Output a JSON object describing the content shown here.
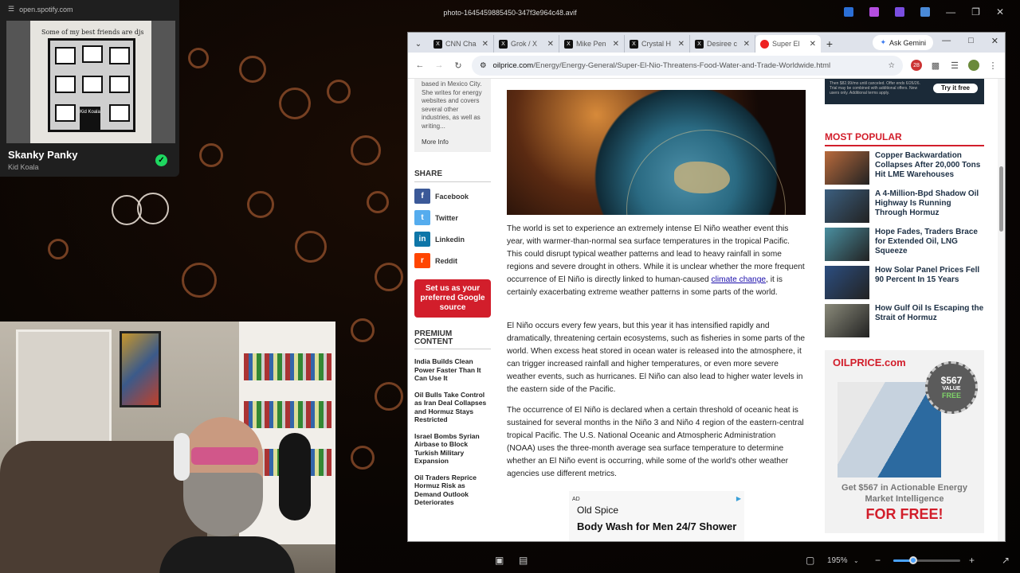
{
  "viewer": {
    "filename": "photo-1645459885450-347f3e964c48.avif",
    "zoom": "195%",
    "zoom_level": 0.3
  },
  "spotify": {
    "url": "open.spotify.com",
    "art_caption": "Some of my best friends are djs",
    "art_sign": "Kid Koala",
    "track": "Skanky Panky",
    "artist": "Kid Koala"
  },
  "browser": {
    "tabs": [
      {
        "label": "CNN Cha",
        "icon": "x-logo-icon"
      },
      {
        "label": "Grok / X",
        "icon": "x-logo-icon"
      },
      {
        "label": "Mike Pen",
        "icon": "x-logo-icon"
      },
      {
        "label": "Crystal H",
        "icon": "x-logo-icon"
      },
      {
        "label": "Desiree c",
        "icon": "x-logo-icon"
      },
      {
        "label": "Super El",
        "icon": "oilprice-icon"
      }
    ],
    "gemini_label": "Ask Gemini",
    "url_domain": "oilprice.com",
    "url_path": "/Energy/Energy-General/Super-El-Nio-Threatens-Food-Water-and-Trade-Worldwide.html",
    "ext_badge": "28"
  },
  "sidebar": {
    "author_bio": "based in Mexico City. She writes for energy websites and covers several other industries, as well as writing...",
    "more_info": "More Info",
    "share_heading": "SHARE",
    "share": [
      {
        "label": "Facebook",
        "glyph": "f",
        "color": "#3b5998"
      },
      {
        "label": "Twitter",
        "glyph": "t",
        "color": "#55acee"
      },
      {
        "label": "Linkedin",
        "glyph": "in",
        "color": "#0e76a8"
      },
      {
        "label": "Reddit",
        "glyph": "r",
        "color": "#ff4500"
      }
    ],
    "google_btn": "Set us as your preferred Google source",
    "premium_heading": "PREMIUM CONTENT",
    "premium": [
      "India Builds Clean Power Faster Than It Can Use It",
      "Oil Bulls Take Control as Iran Deal Collapses and Hormuz Stays Restricted",
      "Israel Bombs Syrian Airbase to Block Turkish Military Expansion",
      "Oil Traders Reprice Hormuz Risk as Demand Outlook Deteriorates"
    ]
  },
  "article": {
    "p1_a": "The world is set to experience an extremely intense El Niño weather event this year, with warmer-than-normal sea surface temperatures in the tropical Pacific. This could disrupt typical weather patterns and lead to heavy rainfall in some regions and severe drought in others. While it is unclear whether the more frequent occurrence of El Niño is directly linked to human-caused ",
    "p1_link": "climate change",
    "p1_b": ", it is certainly exacerbating extreme weather patterns in some parts of the world.",
    "p2": "El Niño occurs every few years, but this year it has intensified rapidly and dramatically, threatening certain ecosystems, such as fisheries in some parts of the world. When excess heat stored in ocean water is released into the atmosphere, it can trigger increased rainfall and higher temperatures, or even more severe weather events, such as hurricanes. El Niño can also lead to higher water levels in the eastern side of the Pacific.",
    "p3": "The occurrence of El Niño is declared when a certain threshold of oceanic heat is sustained for several months in the Niño 3 and Niño 4 region of the eastern-central tropical Pacific. The U.S. National Oceanic and Atmospheric Administration (NOAA) uses the three-month average sea surface temperature to determine whether an El Niño event is occurring, while some of the world's other weather agencies use different metrics.",
    "ad_tag": "AD",
    "ad_brand": "Old Spice",
    "ad_product": "Body Wash for Men 24/7 Shower"
  },
  "rightcol": {
    "promo_fine": "Then $82.99/mo until canceled. Offer ends 6/26/26. Trial may be combined with additional offers. New users only. Additional terms apply.",
    "try_btn": "Try it free",
    "most_popular": "MOST POPULAR",
    "items": [
      {
        "title": "Copper Backwardation Collapses After 20,000 Tons Hit LME Warehouses",
        "color": "#b86a3c"
      },
      {
        "title": "A 4-Million-Bpd Shadow Oil Highway Is Running Through Hormuz",
        "color": "#3c5f7f"
      },
      {
        "title": "Hope Fades, Traders Brace for Extended Oil, LNG Squeeze",
        "color": "#4a8fa0"
      },
      {
        "title": "How Solar Panel Prices Fell 90 Percent In 15 Years",
        "color": "#2c4e80"
      },
      {
        "title": "How Gulf Oil Is Escaping the Strait of Hormuz",
        "color": "#8a8a7a"
      }
    ],
    "ad_logo": "OILPRICE.com",
    "ad_value": "$567",
    "ad_value2": "VALUE",
    "ad_free": "FREE",
    "ad_cta1": "Get $567 in Actionable Energy Market Intelligence",
    "ad_cta2": "FOR FREE!"
  }
}
